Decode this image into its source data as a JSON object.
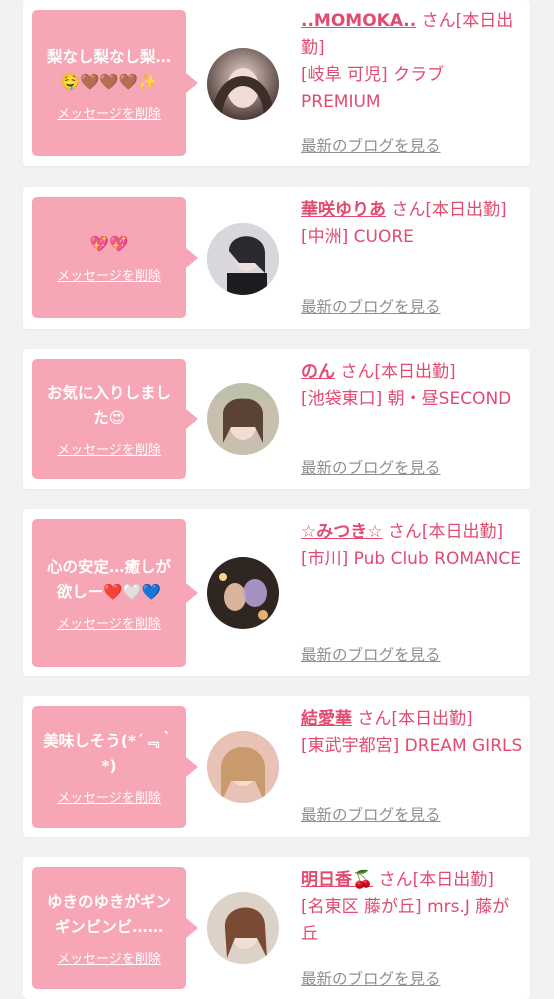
{
  "common": {
    "delete_label": "メッセージを削除",
    "blog_label": "最新のブログを見る",
    "accent_color": "#e24a70",
    "bubble_color": "#f7a6b5"
  },
  "cards": [
    {
      "message": "梨なし梨なし梨…🤤🤎🤎🤎✨",
      "name": "..MOMOKA..",
      "suffix": "さん[本日出勤]",
      "shop": "[岐阜 可児] クラブPREMIUM"
    },
    {
      "message": "💖💖",
      "name": "華咲ゆりあ",
      "suffix": "さん[本日出勤]",
      "shop": "[中洲] CUORE"
    },
    {
      "message": "お気に入りしました😍",
      "name": "のん",
      "suffix": "さん[本日出勤]",
      "shop": "[池袋東口] 朝・昼SECOND"
    },
    {
      "message": "心の安定…癒しが欲しー❤️🤍💙",
      "name": "☆みつき☆",
      "suffix": "さん[本日出勤]",
      "shop": "[市川] Pub Club ROMANCE"
    },
    {
      "message": "美味しそう(*´﹃｀*)",
      "name": "結愛華",
      "suffix": "さん[本日出勤]",
      "shop": "[東武宇都宮] DREAM GIRLS"
    },
    {
      "message": "ゆきのゆきがギンギンビンビ……",
      "name": "明日香🍒",
      "suffix": "さん[本日出勤]",
      "shop": "[名東区 藤が丘] mrs.J 藤が丘"
    }
  ]
}
